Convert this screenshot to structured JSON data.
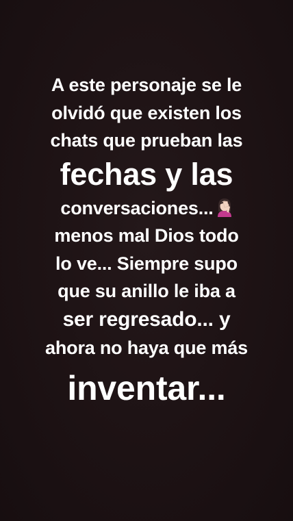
{
  "story": {
    "lines": [
      "A este personaje se le",
      "olvidó que existen los",
      "chats que prueban las",
      "fechas y las",
      "conversaciones...",
      "menos mal Dios todo",
      "lo ve... Siempre supo",
      "que su anillo le iba a",
      "ser regresado... y",
      "ahora no haya que más",
      "inventar..."
    ],
    "emoji": "woman-facepalming-emoji"
  },
  "colors": {
    "background": "#1e1213",
    "text": "#ffffff"
  }
}
